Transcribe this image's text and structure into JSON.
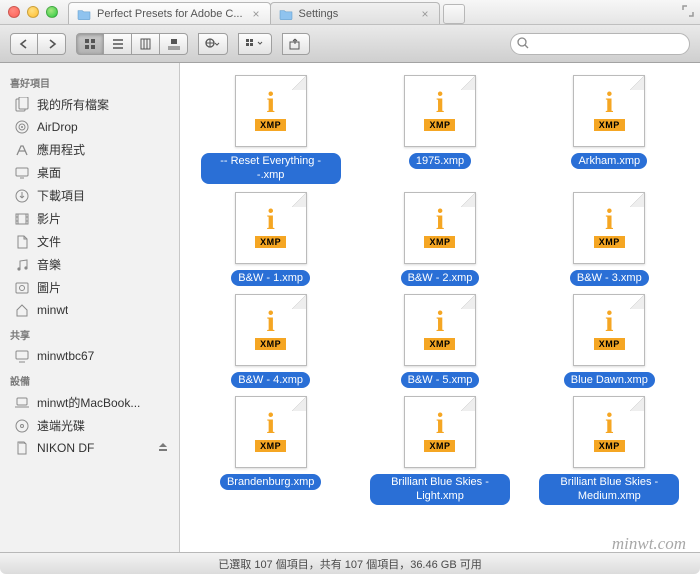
{
  "tabs": [
    {
      "label": "Perfect Presets for Adobe C...",
      "active": true
    },
    {
      "label": "Settings",
      "active": false
    }
  ],
  "search": {
    "placeholder": ""
  },
  "sidebar": {
    "sections": [
      {
        "header": "喜好項目",
        "items": [
          {
            "icon": "docs",
            "label": "我的所有檔案"
          },
          {
            "icon": "airdrop",
            "label": "AirDrop"
          },
          {
            "icon": "apps",
            "label": "應用程式"
          },
          {
            "icon": "desktop",
            "label": "桌面"
          },
          {
            "icon": "downloads",
            "label": "下載項目"
          },
          {
            "icon": "movies",
            "label": "影片"
          },
          {
            "icon": "documents",
            "label": "文件"
          },
          {
            "icon": "music",
            "label": "音樂"
          },
          {
            "icon": "pictures",
            "label": "圖片"
          },
          {
            "icon": "home",
            "label": "minwt"
          }
        ]
      },
      {
        "header": "共享",
        "items": [
          {
            "icon": "display",
            "label": "minwtbc67"
          }
        ]
      },
      {
        "header": "設備",
        "items": [
          {
            "icon": "laptop",
            "label": "minwt的MacBook..."
          },
          {
            "icon": "disc",
            "label": "遠端光碟"
          },
          {
            "icon": "sd",
            "label": "NIKON DF",
            "eject": true
          }
        ]
      }
    ]
  },
  "files": [
    {
      "name": "-- Reset Everything --.xmp"
    },
    {
      "name": "1975.xmp"
    },
    {
      "name": "Arkham.xmp"
    },
    {
      "name": "B&W - 1.xmp"
    },
    {
      "name": "B&W - 2.xmp"
    },
    {
      "name": "B&W - 3.xmp"
    },
    {
      "name": "B&W - 4.xmp"
    },
    {
      "name": "B&W - 5.xmp"
    },
    {
      "name": "Blue Dawn.xmp"
    },
    {
      "name": "Brandenburg.xmp"
    },
    {
      "name": "Brilliant Blue Skies - Light.xmp"
    },
    {
      "name": "Brilliant Blue Skies - Medium.xmp"
    }
  ],
  "thumb_badge": "XMP",
  "status": "已選取 107 個項目，共有 107 個項目，36.46 GB 可用",
  "watermark": "minwt.com"
}
